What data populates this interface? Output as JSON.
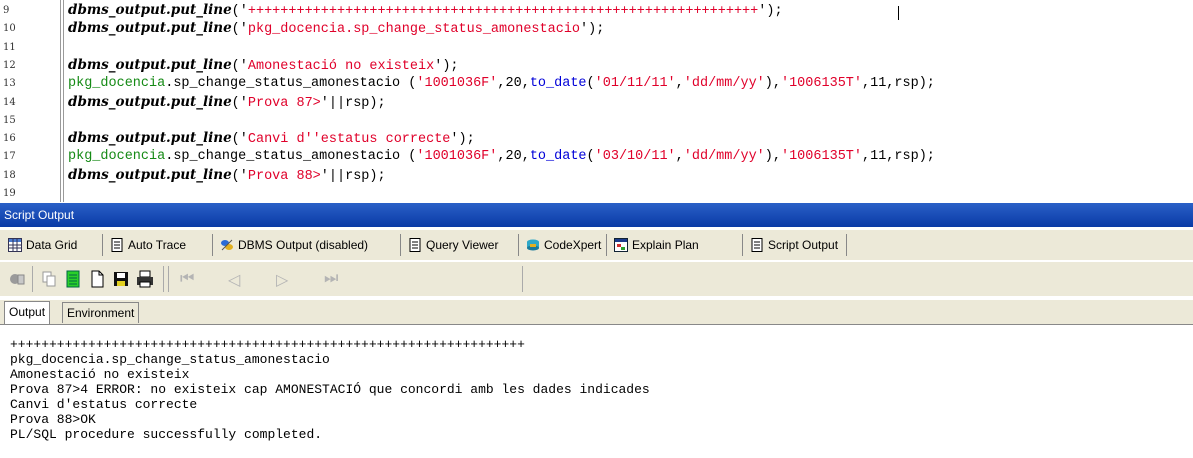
{
  "editor": {
    "lines": [
      {
        "num": "9",
        "tokens": [
          {
            "t": "kw",
            "v": "dbms_output.put_line"
          },
          {
            "t": "punct",
            "v": "('"
          },
          {
            "t": "str",
            "v": "+++++++++++++++++++++++++++++++++++++++++++++++++++++++++++++++"
          },
          {
            "t": "punct",
            "v": "');"
          }
        ]
      },
      {
        "num": "10",
        "tokens": [
          {
            "t": "kw",
            "v": "dbms_output.put_line"
          },
          {
            "t": "punct",
            "v": "('"
          },
          {
            "t": "str",
            "v": "pkg_docencia.sp_change_status_amonestacio"
          },
          {
            "t": "punct",
            "v": "');"
          }
        ]
      },
      {
        "num": "11",
        "tokens": []
      },
      {
        "num": "12",
        "tokens": [
          {
            "t": "kw",
            "v": "dbms_output.put_line"
          },
          {
            "t": "punct",
            "v": "('"
          },
          {
            "t": "str",
            "v": "Amonestació no existeix"
          },
          {
            "t": "punct",
            "v": "');"
          }
        ]
      },
      {
        "num": "13",
        "tokens": [
          {
            "t": "pkg",
            "v": "pkg_docencia"
          },
          {
            "t": "punct",
            "v": ".sp_change_status_amonestacio ("
          },
          {
            "t": "str",
            "v": "'1001036F'"
          },
          {
            "t": "punct",
            "v": ","
          },
          {
            "t": "num",
            "v": "20"
          },
          {
            "t": "punct",
            "v": ","
          },
          {
            "t": "fn",
            "v": "to_date"
          },
          {
            "t": "punct",
            "v": "("
          },
          {
            "t": "str",
            "v": "'01/11/11'"
          },
          {
            "t": "punct",
            "v": ","
          },
          {
            "t": "str",
            "v": "'dd/mm/yy'"
          },
          {
            "t": "punct",
            "v": "),"
          },
          {
            "t": "str",
            "v": "'1006135T'"
          },
          {
            "t": "punct",
            "v": ",11,rsp);"
          }
        ]
      },
      {
        "num": "14",
        "tokens": [
          {
            "t": "kw",
            "v": "dbms_output.put_line"
          },
          {
            "t": "punct",
            "v": "('"
          },
          {
            "t": "str",
            "v": "Prova 87>"
          },
          {
            "t": "punct",
            "v": "'||rsp);"
          }
        ]
      },
      {
        "num": "15",
        "tokens": []
      },
      {
        "num": "16",
        "tokens": [
          {
            "t": "kw",
            "v": "dbms_output.put_line"
          },
          {
            "t": "punct",
            "v": "('"
          },
          {
            "t": "str",
            "v": "Canvi d''estatus correcte"
          },
          {
            "t": "punct",
            "v": "');"
          }
        ]
      },
      {
        "num": "17",
        "tokens": [
          {
            "t": "pkg",
            "v": "pkg_docencia"
          },
          {
            "t": "punct",
            "v": ".sp_change_status_amonestacio ("
          },
          {
            "t": "str",
            "v": "'1001036F'"
          },
          {
            "t": "punct",
            "v": ","
          },
          {
            "t": "num",
            "v": "20"
          },
          {
            "t": "punct",
            "v": ","
          },
          {
            "t": "fn",
            "v": "to_date"
          },
          {
            "t": "punct",
            "v": "("
          },
          {
            "t": "str",
            "v": "'03/10/11'"
          },
          {
            "t": "punct",
            "v": ","
          },
          {
            "t": "str",
            "v": "'dd/mm/yy'"
          },
          {
            "t": "punct",
            "v": "),"
          },
          {
            "t": "str",
            "v": "'1006135T'"
          },
          {
            "t": "punct",
            "v": ",11,rsp);"
          }
        ]
      },
      {
        "num": "18",
        "tokens": [
          {
            "t": "kw",
            "v": "dbms_output.put_line"
          },
          {
            "t": "punct",
            "v": "('"
          },
          {
            "t": "str",
            "v": "Prova 88>"
          },
          {
            "t": "punct",
            "v": "'||rsp);"
          }
        ]
      },
      {
        "num": "19",
        "tokens": []
      }
    ]
  },
  "panel": {
    "title": "Script Output"
  },
  "tabs": [
    {
      "label": "Data Grid",
      "icon": "grid-icon"
    },
    {
      "label": "Auto Trace",
      "icon": "document-icon"
    },
    {
      "label": "DBMS Output (disabled)",
      "icon": "dbms-icon"
    },
    {
      "label": "Query Viewer",
      "icon": "document-icon"
    },
    {
      "label": "CodeXpert",
      "icon": "codexpert-icon"
    },
    {
      "label": "Explain Plan",
      "icon": "explain-plan-icon"
    },
    {
      "label": "Script Output",
      "icon": "document-icon"
    }
  ],
  "output_tabs": [
    {
      "label": "Output"
    },
    {
      "label": "Environment"
    }
  ],
  "output": {
    "lines": [
      "++++++++++++++++++++++++++++++++++++++++++++++++++++++++++++++++++",
      "pkg_docencia.sp_change_status_amonestacio",
      "Amonestació no existeix",
      "Prova 87>4 ERROR: no existeix cap AMONESTACIÓ que concordi amb les dades indicades",
      "Canvi d'estatus correcte",
      "Prova 88>OK",
      "PL/SQL procedure successfully completed."
    ]
  },
  "colors": {
    "string": "#e0002a",
    "package": "#158a15",
    "function": "#0000d8",
    "header": "#0a3aa6"
  }
}
